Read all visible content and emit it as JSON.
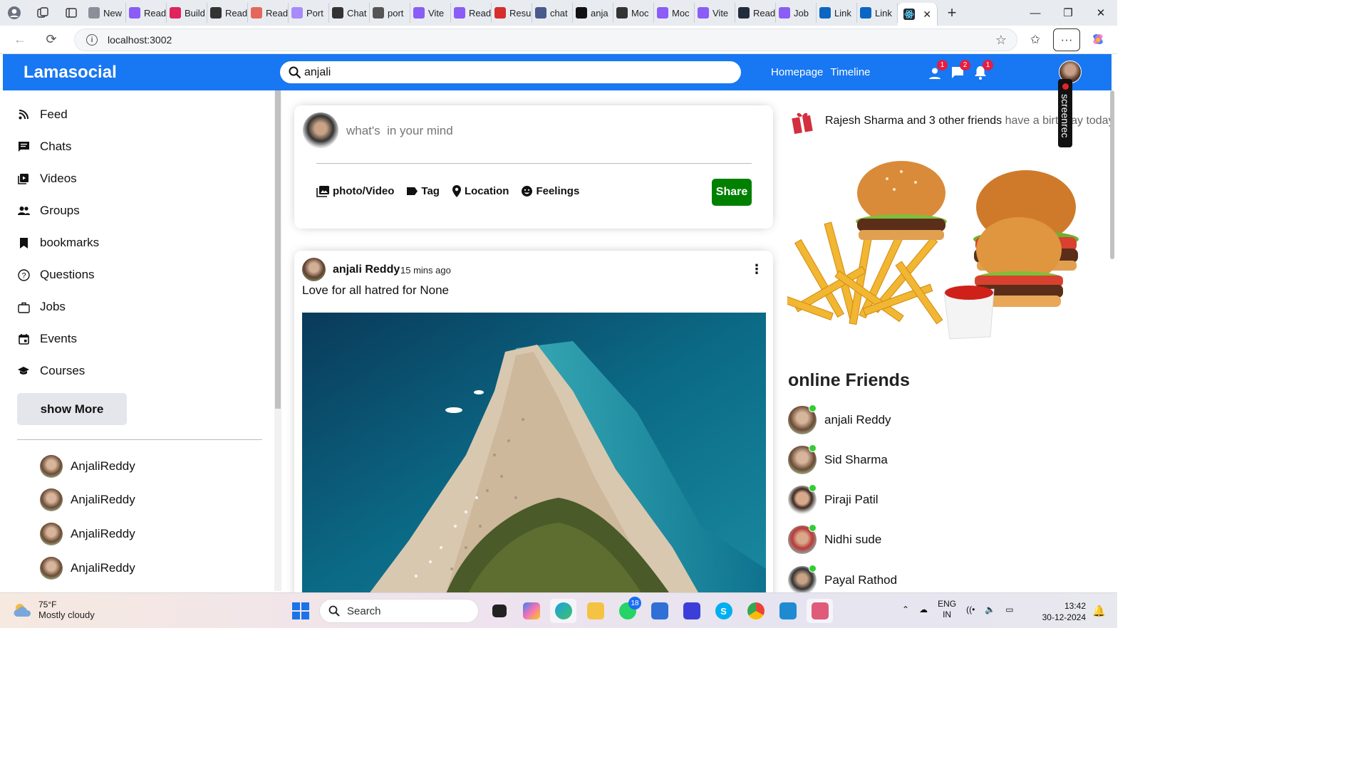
{
  "browser": {
    "tabs": [
      {
        "label": "New",
        "color": "#8a8f98"
      },
      {
        "label": "Read",
        "color": "#8b5cf6"
      },
      {
        "label": "Build",
        "color": "#e0245e"
      },
      {
        "label": "Read",
        "color": "#333333"
      },
      {
        "label": "Read",
        "color": "#e5675b"
      },
      {
        "label": "Port",
        "color": "#a78bfa"
      },
      {
        "label": "Chat",
        "color": "#333333"
      },
      {
        "label": "port",
        "color": "#555555"
      },
      {
        "label": "Vite",
        "color": "#8b5cf6"
      },
      {
        "label": "Read",
        "color": "#8b5cf6"
      },
      {
        "label": "Resu",
        "color": "#d62d2d"
      },
      {
        "label": "chat",
        "color": "#4a5a8a"
      },
      {
        "label": "anja",
        "color": "#111111"
      },
      {
        "label": "Moc",
        "color": "#333333"
      },
      {
        "label": "Moc",
        "color": "#8b5cf6"
      },
      {
        "label": "Vite",
        "color": "#8b5cf6"
      },
      {
        "label": "Read",
        "color": "#222b3a"
      },
      {
        "label": "Job",
        "color": "#8b5cf6"
      },
      {
        "label": "Link",
        "color": "#0a66c2"
      },
      {
        "label": "Link",
        "color": "#0a66c2"
      }
    ],
    "url": "localhost:3002"
  },
  "topbar": {
    "logo": "Lamasocial",
    "search_value": "anjali",
    "links": [
      "Homepage",
      "Timeline"
    ],
    "badges": [
      "1",
      "2",
      "1"
    ],
    "color": "#1877f2"
  },
  "screenrec": "screenrec",
  "sidebar": {
    "items": [
      {
        "label": "Feed",
        "icon": "rss-feed-icon"
      },
      {
        "label": "Chats",
        "icon": "chat-icon"
      },
      {
        "label": "Videos",
        "icon": "play-circle-icon"
      },
      {
        "label": "Groups",
        "icon": "group-icon"
      },
      {
        "label": "bookmarks",
        "icon": "bookmark-icon"
      },
      {
        "label": "Questions",
        "icon": "help-outline-icon"
      },
      {
        "label": "Jobs",
        "icon": "work-outline-icon"
      },
      {
        "label": "Events",
        "icon": "event-icon"
      },
      {
        "label": "Courses",
        "icon": "school-icon"
      }
    ],
    "show_more": "show More",
    "friends": [
      "AnjaliReddy",
      "AnjaliReddy",
      "AnjaliReddy",
      "AnjaliReddy"
    ]
  },
  "share": {
    "placeholder": "what's  in your mind",
    "options": [
      "photo/Video",
      "Tag",
      "Location",
      "Feelings"
    ],
    "button": "Share",
    "button_color": "#008000"
  },
  "post": {
    "username": "anjali Reddy",
    "time": "15 mins ago",
    "text": "Love for all hatred for None"
  },
  "rightbar": {
    "birthday_names": "Rajesh Sharma and 3 other friends",
    "birthday_rest": " have a birthday today",
    "online_title": "online Friends",
    "online_friends": [
      "anjali Reddy",
      "Sid Sharma",
      "Piraji Patil",
      "Nidhi sude",
      "Payal Rathod"
    ]
  },
  "taskbar": {
    "temperature": "75°F",
    "condition": "Mostly cloudy",
    "search": "Search",
    "whatsapp_badge": "18",
    "lang1": "ENG",
    "lang2": "IN",
    "time": "13:42",
    "date": "30-12-2024"
  }
}
